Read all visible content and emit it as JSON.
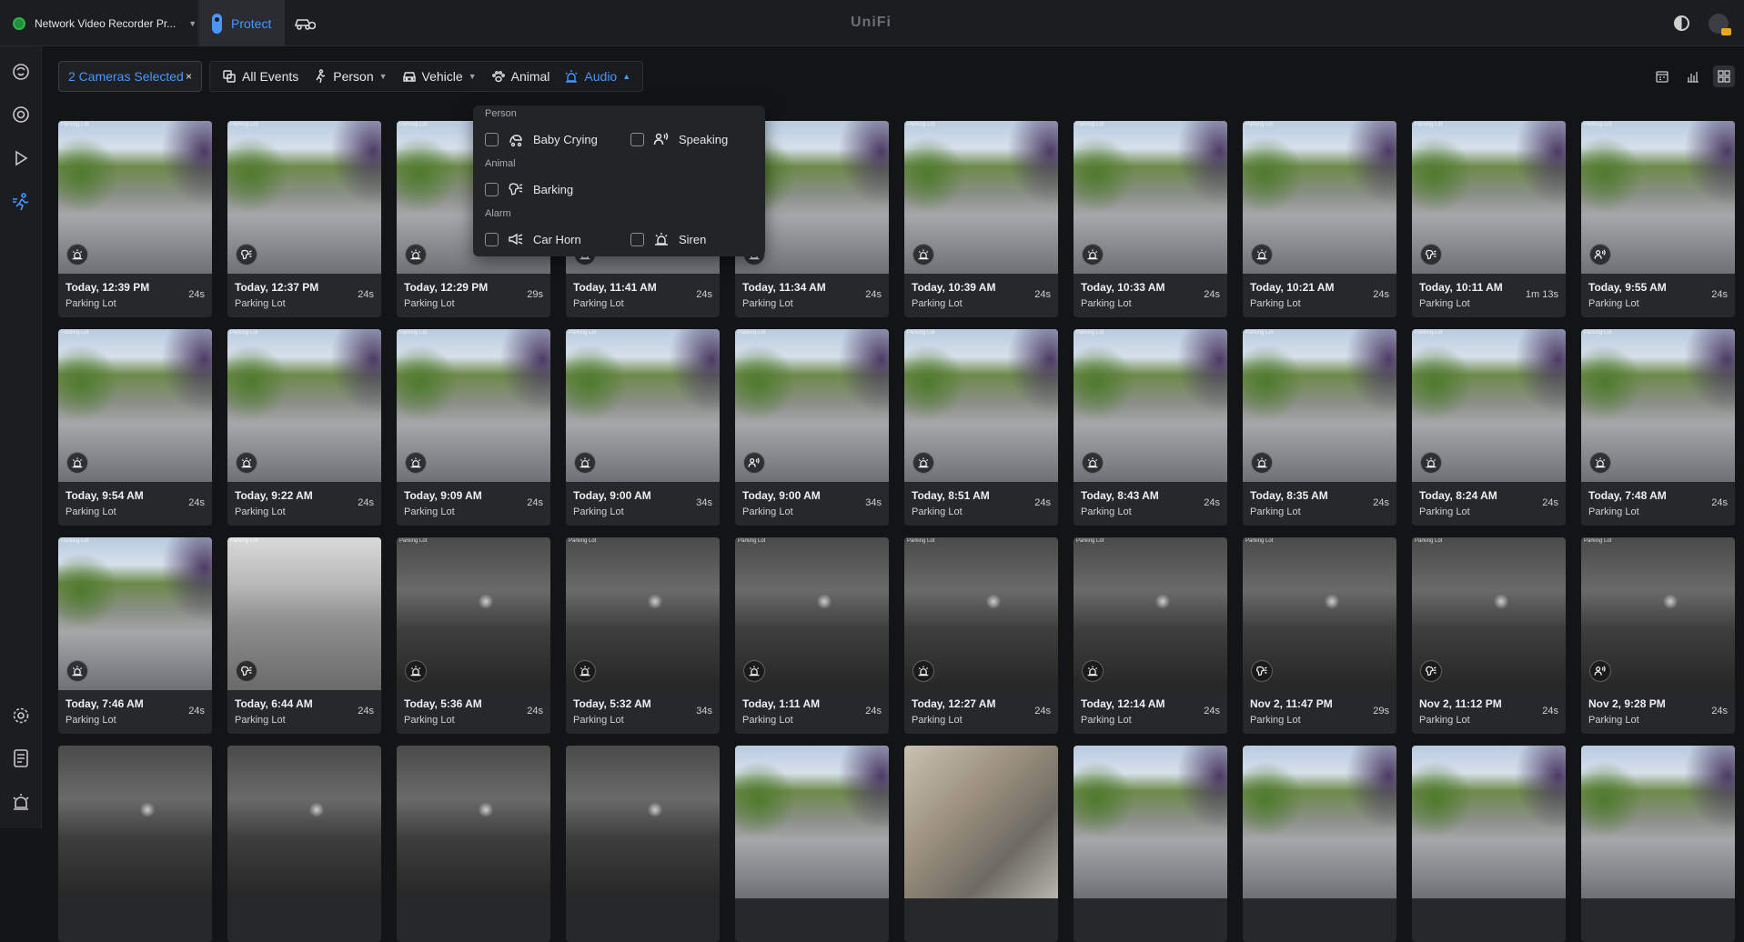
{
  "topbar": {
    "app_switcher": "Network Video Recorder Pr...",
    "active_app": "Protect",
    "brand": "UniFi"
  },
  "filters": {
    "cameras_chip": "2 Cameras Selected",
    "clear": "×",
    "all_events": "All Events",
    "person": "Person",
    "vehicle": "Vehicle",
    "animal": "Animal",
    "audio": "Audio"
  },
  "audio_dropdown": {
    "sections": [
      {
        "label": "Person",
        "items": [
          "Baby Crying",
          "Speaking"
        ]
      },
      {
        "label": "Animal",
        "items": [
          "Barking"
        ]
      },
      {
        "label": "Alarm",
        "items": [
          "Car Horn",
          "Siren"
        ]
      }
    ]
  },
  "colors": {
    "accent": "#4797ff",
    "background": "#131416",
    "card": "#26282c"
  },
  "events": [
    {
      "time": "Today, 12:39 PM",
      "camera": "Parking Lot",
      "duration": "24s",
      "icon": "siren-icon",
      "scene": "day"
    },
    {
      "time": "Today, 12:37 PM",
      "camera": "Parking Lot",
      "duration": "24s",
      "icon": "barking-icon",
      "scene": "day"
    },
    {
      "time": "Today, 12:29 PM",
      "camera": "Parking Lot",
      "duration": "29s",
      "icon": "siren-icon",
      "scene": "day"
    },
    {
      "time": "Today, 11:41 AM",
      "camera": "Parking Lot",
      "duration": "24s",
      "icon": "siren-icon",
      "scene": "day"
    },
    {
      "time": "Today, 11:34 AM",
      "camera": "Parking Lot",
      "duration": "24s",
      "icon": "siren-icon",
      "scene": "day"
    },
    {
      "time": "Today, 10:39 AM",
      "camera": "Parking Lot",
      "duration": "24s",
      "icon": "siren-icon",
      "scene": "day"
    },
    {
      "time": "Today, 10:33 AM",
      "camera": "Parking Lot",
      "duration": "24s",
      "icon": "siren-icon",
      "scene": "day"
    },
    {
      "time": "Today, 10:21 AM",
      "camera": "Parking Lot",
      "duration": "24s",
      "icon": "siren-icon",
      "scene": "day"
    },
    {
      "time": "Today, 10:11 AM",
      "camera": "Parking Lot",
      "duration": "1m 13s",
      "icon": "barking-icon",
      "scene": "day"
    },
    {
      "time": "Today, 9:55 AM",
      "camera": "Parking Lot",
      "duration": "24s",
      "icon": "speaking-icon",
      "scene": "day"
    },
    {
      "time": "Today, 9:54 AM",
      "camera": "Parking Lot",
      "duration": "24s",
      "icon": "siren-icon",
      "scene": "day"
    },
    {
      "time": "Today, 9:22 AM",
      "camera": "Parking Lot",
      "duration": "24s",
      "icon": "siren-icon",
      "scene": "day"
    },
    {
      "time": "Today, 9:09 AM",
      "camera": "Parking Lot",
      "duration": "24s",
      "icon": "siren-icon",
      "scene": "day"
    },
    {
      "time": "Today, 9:00 AM",
      "camera": "Parking Lot",
      "duration": "34s",
      "icon": "siren-icon",
      "scene": "day"
    },
    {
      "time": "Today, 9:00 AM",
      "camera": "Parking Lot",
      "duration": "34s",
      "icon": "speaking-icon",
      "scene": "day"
    },
    {
      "time": "Today, 8:51 AM",
      "camera": "Parking Lot",
      "duration": "24s",
      "icon": "siren-icon",
      "scene": "day"
    },
    {
      "time": "Today, 8:43 AM",
      "camera": "Parking Lot",
      "duration": "24s",
      "icon": "siren-icon",
      "scene": "day"
    },
    {
      "time": "Today, 8:35 AM",
      "camera": "Parking Lot",
      "duration": "24s",
      "icon": "siren-icon",
      "scene": "day"
    },
    {
      "time": "Today, 8:24 AM",
      "camera": "Parking Lot",
      "duration": "24s",
      "icon": "siren-icon",
      "scene": "day"
    },
    {
      "time": "Today, 7:48 AM",
      "camera": "Parking Lot",
      "duration": "24s",
      "icon": "siren-icon",
      "scene": "day"
    },
    {
      "time": "Today, 7:46 AM",
      "camera": "Parking Lot",
      "duration": "24s",
      "icon": "siren-icon",
      "scene": "day"
    },
    {
      "time": "Today, 6:44 AM",
      "camera": "Parking Lot",
      "duration": "24s",
      "icon": "barking-icon",
      "scene": "dim"
    },
    {
      "time": "Today, 5:36 AM",
      "camera": "Parking Lot",
      "duration": "24s",
      "icon": "siren-icon",
      "scene": "night"
    },
    {
      "time": "Today, 5:32 AM",
      "camera": "Parking Lot",
      "duration": "34s",
      "icon": "siren-icon",
      "scene": "night"
    },
    {
      "time": "Today, 1:11 AM",
      "camera": "Parking Lot",
      "duration": "24s",
      "icon": "siren-icon",
      "scene": "night"
    },
    {
      "time": "Today, 12:27 AM",
      "camera": "Parking Lot",
      "duration": "24s",
      "icon": "siren-icon",
      "scene": "night"
    },
    {
      "time": "Today, 12:14 AM",
      "camera": "Parking Lot",
      "duration": "24s",
      "icon": "siren-icon",
      "scene": "night"
    },
    {
      "time": "Nov 2, 11:47 PM",
      "camera": "Parking Lot",
      "duration": "29s",
      "icon": "barking-icon",
      "scene": "night"
    },
    {
      "time": "Nov 2, 11:12 PM",
      "camera": "Parking Lot",
      "duration": "24s",
      "icon": "barking-icon",
      "scene": "night"
    },
    {
      "time": "Nov 2, 9:28 PM",
      "camera": "Parking Lot",
      "duration": "24s",
      "icon": "speaking-icon",
      "scene": "night"
    },
    {
      "time": "",
      "camera": "",
      "duration": "",
      "icon": "",
      "scene": "night"
    },
    {
      "time": "",
      "camera": "",
      "duration": "",
      "icon": "",
      "scene": "night"
    },
    {
      "time": "",
      "camera": "",
      "duration": "",
      "icon": "",
      "scene": "night"
    },
    {
      "time": "",
      "camera": "",
      "duration": "",
      "icon": "",
      "scene": "night"
    },
    {
      "time": "",
      "camera": "",
      "duration": "",
      "icon": "",
      "scene": "day"
    },
    {
      "time": "",
      "camera": "",
      "duration": "",
      "icon": "",
      "scene": "indoor"
    },
    {
      "time": "",
      "camera": "",
      "duration": "",
      "icon": "",
      "scene": "day"
    },
    {
      "time": "",
      "camera": "",
      "duration": "",
      "icon": "",
      "scene": "day"
    },
    {
      "time": "",
      "camera": "",
      "duration": "",
      "icon": "",
      "scene": "day"
    },
    {
      "time": "",
      "camera": "",
      "duration": "",
      "icon": "",
      "scene": "day"
    }
  ]
}
